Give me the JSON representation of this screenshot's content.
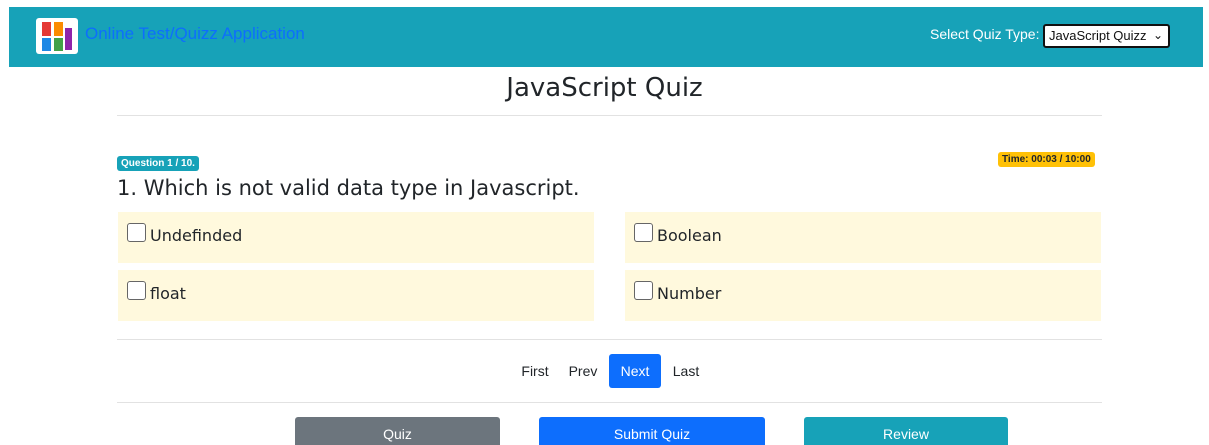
{
  "header": {
    "app_title": "Online Test/Quizz Application",
    "quiz_type_label": "Select Quiz Type:",
    "quiz_type_selected": "JavaScript Quizz"
  },
  "main": {
    "title": "JavaScript Quiz",
    "question_badge": "Question 1 / 10.",
    "timer": "Time: 00:03 / 10:00",
    "question": "1. Which is not valid data type in Javascript.",
    "options": [
      {
        "label": "Undefinded",
        "checked": false
      },
      {
        "label": "Boolean",
        "checked": false
      },
      {
        "label": "float",
        "checked": false
      },
      {
        "label": "Number",
        "checked": false
      }
    ]
  },
  "pager": {
    "first": "First",
    "prev": "Prev",
    "next": "Next",
    "last": "Last",
    "active": "Next"
  },
  "actions": {
    "quiz": "Quiz",
    "submit": "Submit Quiz",
    "review": "Review"
  },
  "colors": {
    "navbar": "#17a2b8",
    "primary": "#0d6efd",
    "secondary": "#6c757d",
    "warning": "#ffc107",
    "option_bg": "#fff9dd"
  },
  "icons": {
    "logo": "quiz-app-logo-icon",
    "select_chevron": "chevron-down-icon",
    "checkbox": "checkbox-icon"
  }
}
